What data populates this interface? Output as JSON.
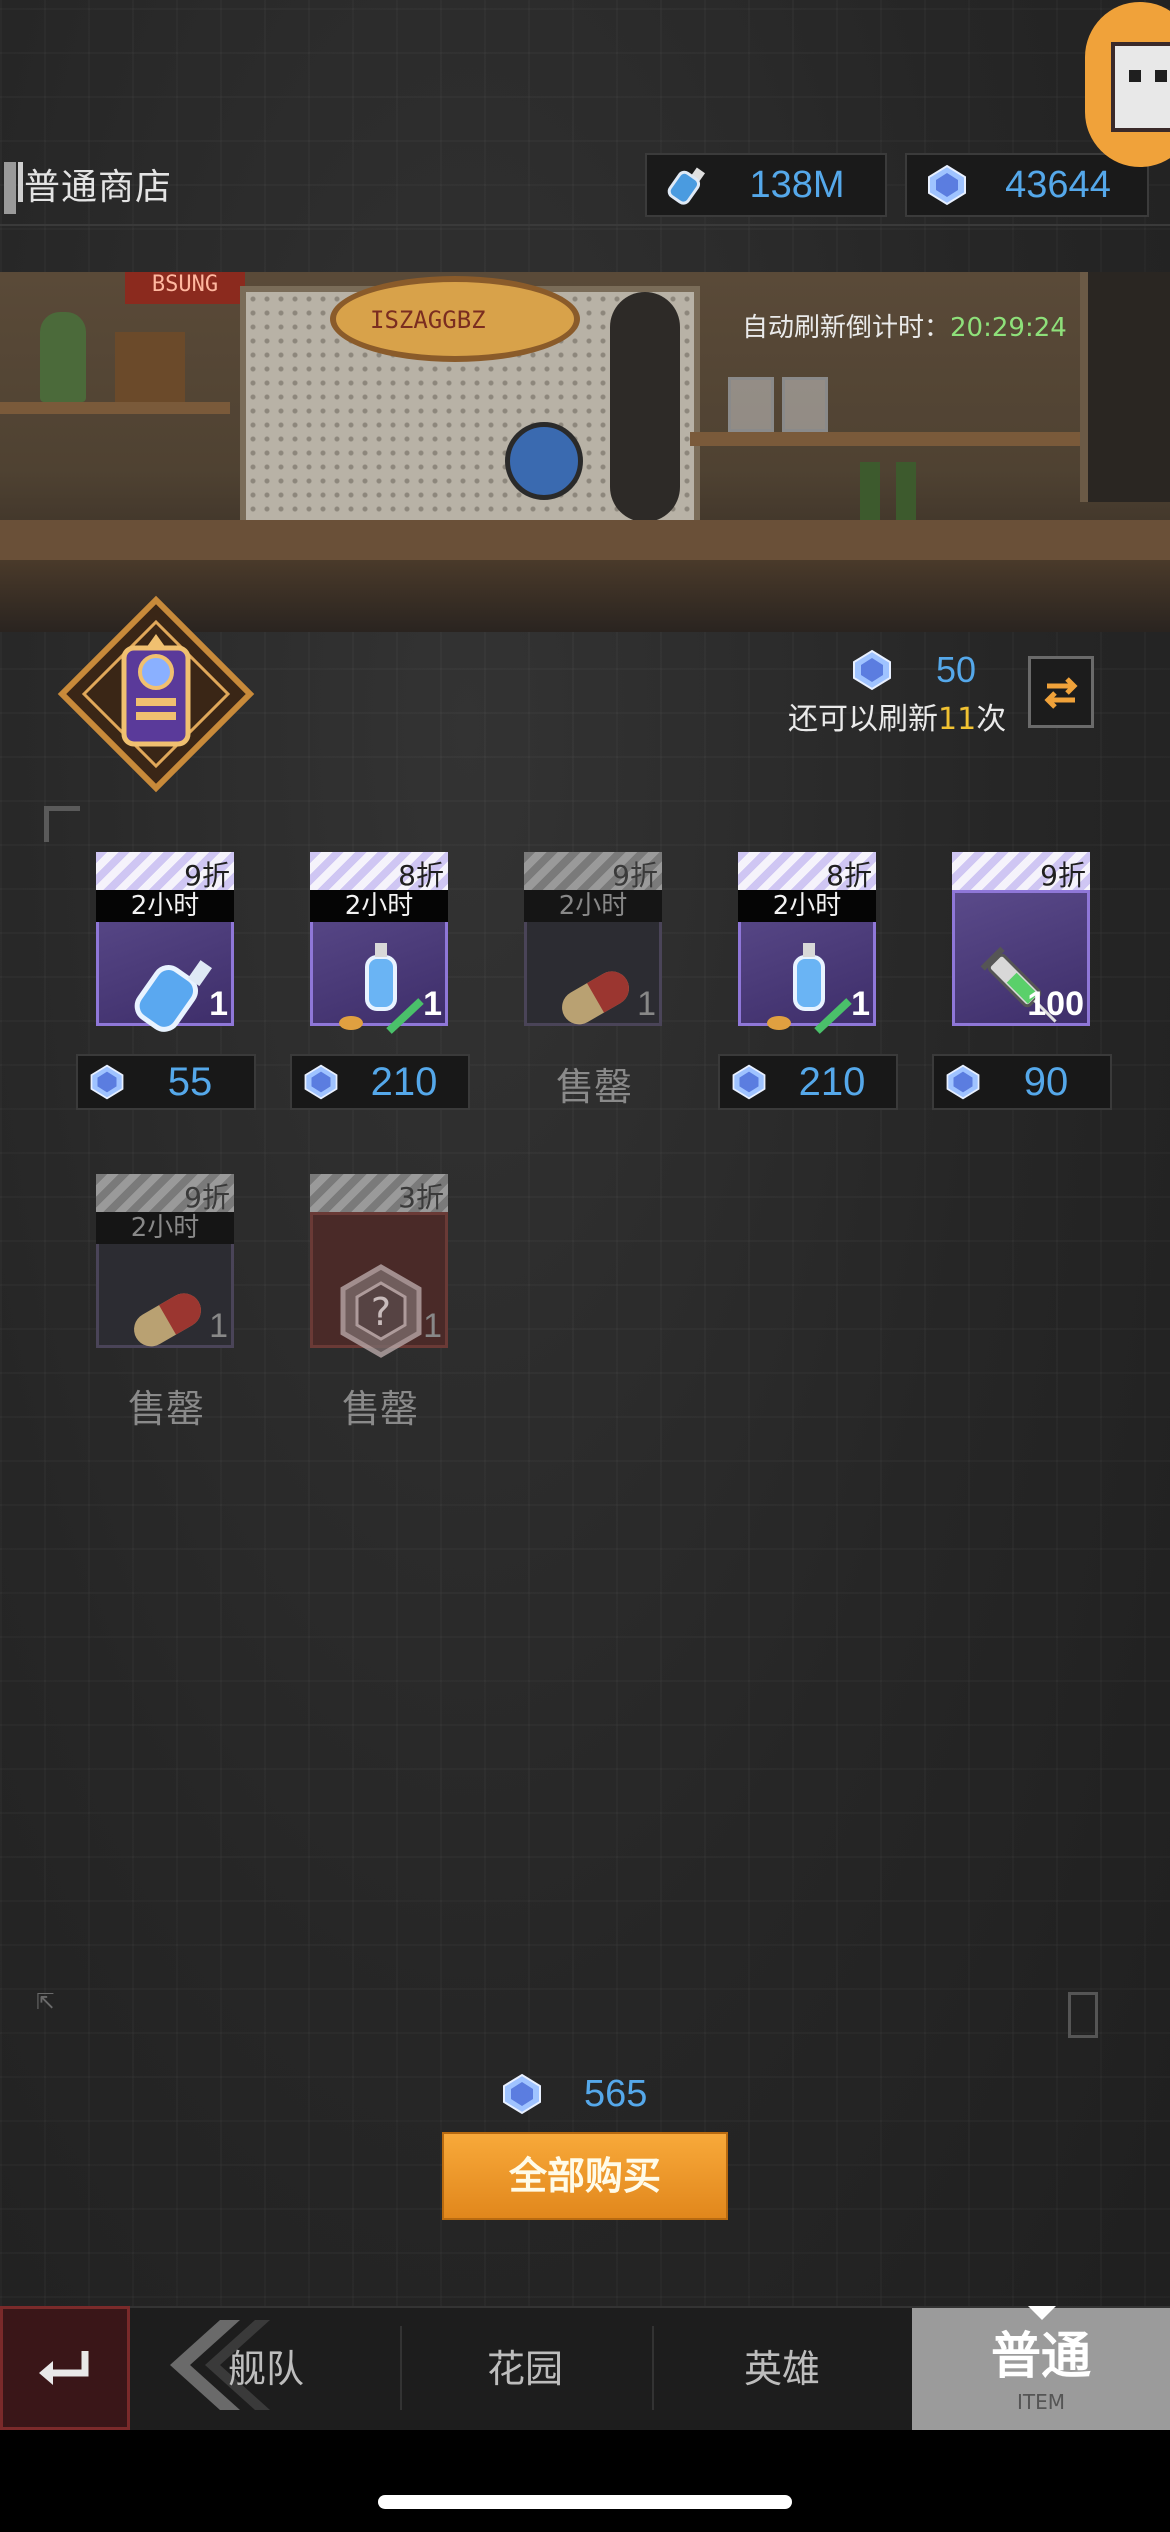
{
  "header": {
    "shop_title": "普通商店",
    "resources": [
      {
        "icon": "bottle-icon",
        "value": "138M"
      },
      {
        "icon": "gem-icon",
        "value": "43644"
      }
    ]
  },
  "scene": {
    "countdown_label": "自动刷新倒计时：",
    "countdown_time": "20:29:24",
    "sign_text": "ISZAGGBZ",
    "dice_sign": "BSUNG"
  },
  "refresh": {
    "cost": "50",
    "count_prefix": "还可以刷新",
    "count_value": "11",
    "count_suffix": "次"
  },
  "items": [
    {
      "discount": "9折",
      "timer": "2小时",
      "art": "blue-potion-icon",
      "qty": "1",
      "price": "55",
      "sold_out": false
    },
    {
      "discount": "8折",
      "timer": "2小时",
      "art": "flask-syringe-icon",
      "qty": "1",
      "price": "210",
      "sold_out": false
    },
    {
      "discount": "9折",
      "timer": "2小时",
      "art": "capsule-icon",
      "qty": "1",
      "price": "",
      "sold_out": true,
      "sold_label": "售罄"
    },
    {
      "discount": "8折",
      "timer": "2小时",
      "art": "flask-syringe-icon",
      "qty": "1",
      "price": "210",
      "sold_out": false
    },
    {
      "discount": "9折",
      "timer": "",
      "art": "syringe-icon",
      "qty": "100",
      "price": "90",
      "sold_out": false
    },
    {
      "discount": "9折",
      "timer": "2小时",
      "art": "capsule-icon",
      "qty": "1",
      "price": "",
      "sold_out": true,
      "sold_label": "售罄"
    },
    {
      "discount": "3折",
      "timer": "",
      "art": "mystery-badge-icon",
      "qty": "1",
      "price": "",
      "sold_out": true,
      "sold_label": "售罄"
    }
  ],
  "footer": {
    "total_cost": "565",
    "buy_all_label": "全部购买"
  },
  "nav": {
    "tabs": [
      "舰队",
      "花园",
      "英雄"
    ],
    "active_label": "普通",
    "active_sub": "ITEM"
  },
  "colors": {
    "gem_blue": "#55a8ea",
    "buy_orange": "#f39a2a",
    "purple_frame": "#8f77d8",
    "timer_green": "#8ee07a"
  }
}
